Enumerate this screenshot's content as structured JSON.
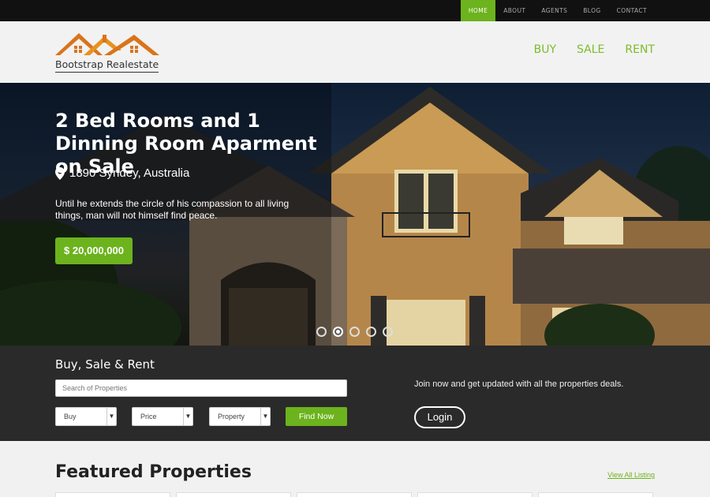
{
  "topnav": {
    "items": [
      "HOME",
      "ABOUT",
      "AGENTS",
      "BLOG",
      "CONTACT"
    ],
    "active": "HOME"
  },
  "header": {
    "logo_text": "Bootstrap Realestate",
    "nav": [
      "BUY",
      "SALE",
      "RENT"
    ]
  },
  "hero": {
    "title": "2 Bed Rooms and 1 Dinning Room Aparment on Sale",
    "location": "1890 Syndey, Australia",
    "description": "Until he extends the circle of his compassion to all living things, man will not himself find peace.",
    "price": "$ 20,000,000",
    "slides": 5,
    "active_slide": 2
  },
  "search": {
    "title": "Buy, Sale & Rent",
    "placeholder": "Search of Properties",
    "selects": [
      "Buy",
      "Price",
      "Property"
    ],
    "find_label": "Find Now",
    "join_text": "Join now and get updated with all the properties deals.",
    "login_label": "Login"
  },
  "featured": {
    "title": "Featured Properties",
    "view_all": "View All Listing"
  },
  "colors": {
    "accent": "#6cb31d",
    "topbar": "#111111",
    "band": "#2a2a2a"
  },
  "icons": [
    "map-marker-icon",
    "chevron-down-icon",
    "house-logo-icon"
  ]
}
